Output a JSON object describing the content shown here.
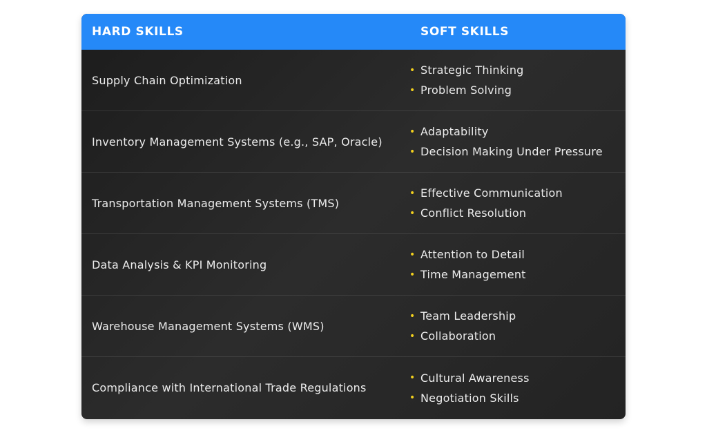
{
  "header": {
    "hard_label": "HARD SKILLS",
    "soft_label": "SOFT SKILLS"
  },
  "colors": {
    "header_bg": "#2589f8",
    "bullet": "#f2d01e",
    "card_bg": "#262626"
  },
  "rows": [
    {
      "hard": "Supply Chain Optimization",
      "soft": [
        "Strategic Thinking",
        "Problem Solving"
      ]
    },
    {
      "hard": "Inventory Management Systems (e.g., SAP, Oracle)",
      "soft": [
        "Adaptability",
        "Decision Making Under Pressure"
      ]
    },
    {
      "hard": "Transportation Management Systems (TMS)",
      "soft": [
        "Effective Communication",
        "Conflict Resolution"
      ]
    },
    {
      "hard": "Data Analysis & KPI Monitoring",
      "soft": [
        "Attention to Detail",
        "Time Management"
      ]
    },
    {
      "hard": "Warehouse Management Systems (WMS)",
      "soft": [
        "Team Leadership",
        "Collaboration"
      ]
    },
    {
      "hard": "Compliance with International Trade Regulations",
      "soft": [
        "Cultural Awareness",
        "Negotiation Skills"
      ]
    }
  ]
}
